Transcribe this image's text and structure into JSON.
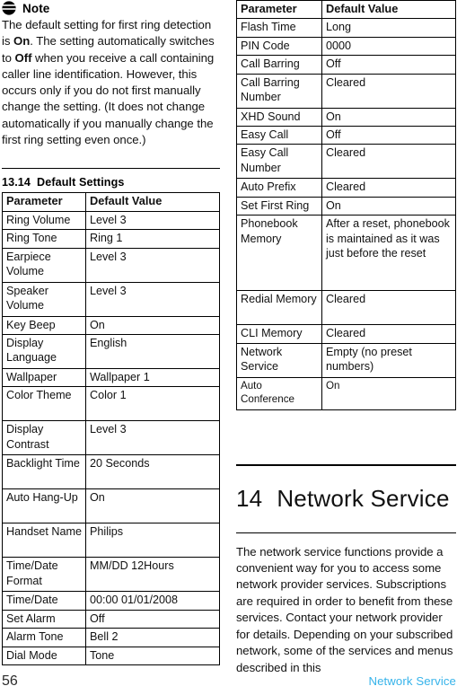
{
  "note": {
    "icon": "note-icon",
    "title": "Note",
    "body_html": "The default setting for first ring detection is <b>On</b>. The setting automatically switches to <b>Off</b> when you receive a call containing caller line identification. However, this occurs only if you do not first manually change the setting. (It does not change automatically if you manually change the first ring setting even once.)"
  },
  "section": {
    "number": "13.14",
    "title": "Default Settings"
  },
  "table_left": {
    "headers": [
      "Parameter",
      "Default Value"
    ],
    "rows": [
      {
        "parameter": "Ring Volume",
        "value": "Level 3"
      },
      {
        "parameter": "Ring Tone",
        "value": "Ring 1"
      },
      {
        "parameter": "Earpiece Volume",
        "value": "Level 3"
      },
      {
        "parameter": "Speaker Volume",
        "value": "Level 3"
      },
      {
        "parameter": "Key Beep",
        "value": "On"
      },
      {
        "parameter": "Display Language",
        "value": "English"
      },
      {
        "parameter": "Wallpaper",
        "value": "Wallpaper 1"
      },
      {
        "parameter": "Color Theme",
        "value": "Color 1"
      },
      {
        "parameter": "Display Contrast",
        "value": "Level 3"
      },
      {
        "parameter": "Backlight Time",
        "value": "20 Seconds"
      },
      {
        "parameter": "Auto Hang-Up",
        "value": "On"
      },
      {
        "parameter": "Handset Name",
        "value": "Philips"
      },
      {
        "parameter": "Time/Date Format",
        "value": "MM/DD 12Hours"
      },
      {
        "parameter": "Time/Date",
        "value": "00:00 01/01/2008"
      },
      {
        "parameter": "Set Alarm",
        "value": "Off"
      },
      {
        "parameter": "Alarm Tone",
        "value": "Bell 2"
      },
      {
        "parameter": "Dial Mode",
        "value": "Tone"
      }
    ]
  },
  "table_right": {
    "headers": [
      "Parameter",
      "Default Value"
    ],
    "rows": [
      {
        "parameter": "Flash Time",
        "value": "Long"
      },
      {
        "parameter": "PIN Code",
        "value": "0000"
      },
      {
        "parameter": "Call Barring",
        "value": "Off"
      },
      {
        "parameter": "Call Barring Number",
        "value": "Cleared"
      },
      {
        "parameter": "XHD Sound",
        "value": "On"
      },
      {
        "parameter": "Easy Call",
        "value": "Off"
      },
      {
        "parameter": "Easy Call Number",
        "value": "Cleared"
      },
      {
        "parameter": "Auto Prefix",
        "value": "Cleared"
      },
      {
        "parameter": "Set First Ring",
        "value": "On"
      },
      {
        "parameter": "Phonebook Memory",
        "value": "After a reset, phonebook is maintained as it was just before the reset"
      },
      {
        "parameter": "Redial Memory",
        "value": "Cleared"
      },
      {
        "parameter": "CLI Memory",
        "value": "Cleared"
      },
      {
        "parameter": "Network Service",
        "value": "Empty (no preset numbers)"
      },
      {
        "parameter": "Auto Conference",
        "value": "On"
      }
    ]
  },
  "chapter": {
    "number": "14",
    "title": "Network Service",
    "paragraph": "The network service functions provide a convenient way for you to access some network provider services. Subscriptions are required in order to benefit from these services. Contact your network provider for details. Depending on your subscribed network, some of the services and menus described in this"
  },
  "footer": {
    "page_number": "56",
    "chapter_label": "Network Service",
    "chapter_label_color": "#36b3ea"
  }
}
